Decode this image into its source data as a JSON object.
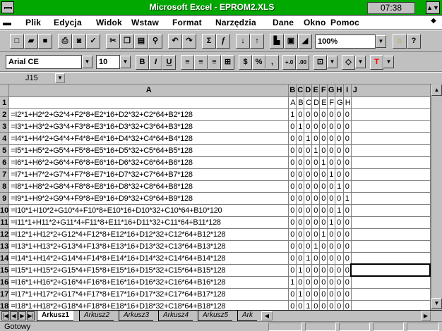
{
  "window": {
    "title": "Microsoft Excel - EPROM2.XLS",
    "clock": "07:38"
  },
  "menu": [
    "Plik",
    "Edycja",
    "Widok",
    "Wstaw",
    "Format",
    "Narzędzia",
    "Dane",
    "Okno",
    "Pomoc"
  ],
  "formatting": {
    "font": "Arial CE",
    "size": "10",
    "zoom": "100%"
  },
  "formula_bar": {
    "cell_ref": "J15"
  },
  "columns": [
    "A",
    "B",
    "C",
    "D",
    "E",
    "F",
    "G",
    "H",
    "I",
    "J"
  ],
  "row_numbers": [
    "1",
    "2",
    "3",
    "4",
    "5",
    "6",
    "7",
    "8",
    "9",
    "10",
    "11",
    "12",
    "13",
    "14",
    "15",
    "16",
    "17",
    "18",
    "19"
  ],
  "header_row": [
    "",
    "A",
    "B",
    "C",
    "D",
    "E",
    "F",
    "G",
    "H"
  ],
  "rows": [
    {
      "formula": "=I2*1+H2*2+G2*4+F2*8+E2*16+D2*32+C2*64+B2*128",
      "bits": [
        "1",
        "0",
        "0",
        "0",
        "0",
        "0",
        "0",
        "0"
      ]
    },
    {
      "formula": "=I3*1+H3*2+G3*4+F3*8+E3*16+D3*32+C3*64+B3*128",
      "bits": [
        "0",
        "1",
        "0",
        "0",
        "0",
        "0",
        "0",
        "0"
      ]
    },
    {
      "formula": "=I4*1+H4*2+G4*4+F4*8+E4*16+D4*32+C4*64+B4*128",
      "bits": [
        "0",
        "0",
        "1",
        "0",
        "0",
        "0",
        "0",
        "0"
      ]
    },
    {
      "formula": "=I5*1+H5*2+G5*4+F5*8+E5*16+D5*32+C5*64+B5*128",
      "bits": [
        "0",
        "0",
        "0",
        "1",
        "0",
        "0",
        "0",
        "0"
      ]
    },
    {
      "formula": "=I6*1+H6*2+G6*4+F6*8+E6*16+D6*32+C6*64+B6*128",
      "bits": [
        "0",
        "0",
        "0",
        "0",
        "1",
        "0",
        "0",
        "0"
      ]
    },
    {
      "formula": "=I7*1+H7*2+G7*4+F7*8+E7*16+D7*32+C7*64+B7*128",
      "bits": [
        "0",
        "0",
        "0",
        "0",
        "0",
        "1",
        "0",
        "0"
      ]
    },
    {
      "formula": "=I8*1+H8*2+G8*4+F8*8+E8*16+D8*32+C8*64+B8*128",
      "bits": [
        "0",
        "0",
        "0",
        "0",
        "0",
        "0",
        "1",
        "0"
      ]
    },
    {
      "formula": "=I9*1+H9*2+G9*4+F9*8+E9*16+D9*32+C9*64+B9*128",
      "bits": [
        "0",
        "0",
        "0",
        "0",
        "0",
        "0",
        "0",
        "1"
      ]
    },
    {
      "formula": "=I10*1+I10*2+G10*4+F10*8+E10*16+D10*32+C10*64+B10*120",
      "bits": [
        "0",
        "0",
        "0",
        "0",
        "0",
        "0",
        "1",
        "0"
      ]
    },
    {
      "formula": "=I11*1+H11*2+G11*4+F11*8+E11*16+D11*32+C11*64+B11*128",
      "bits": [
        "0",
        "0",
        "0",
        "0",
        "0",
        "1",
        "0",
        "0"
      ]
    },
    {
      "formula": "=I12*1+H12*2+G12*4+F12*8+E12*16+D12*32+C12*64+B12*128",
      "bits": [
        "0",
        "0",
        "0",
        "0",
        "1",
        "0",
        "0",
        "0"
      ]
    },
    {
      "formula": "=I13*1+H13*2+G13*4+F13*8+E13*16+D13*32+C13*64+B13*128",
      "bits": [
        "0",
        "0",
        "0",
        "1",
        "0",
        "0",
        "0",
        "0"
      ]
    },
    {
      "formula": "=I14*1+H14*2+G14*4+F14*8+E14*16+D14*32+C14*64+B14*128",
      "bits": [
        "0",
        "0",
        "1",
        "0",
        "0",
        "0",
        "0",
        "0"
      ]
    },
    {
      "formula": "=I15*1+H15*2+G15*4+F15*8+E15*16+D15*32+C15*64+B15*128",
      "bits": [
        "0",
        "1",
        "0",
        "0",
        "0",
        "0",
        "0",
        "0"
      ]
    },
    {
      "formula": "=I16*1+H16*2+G16*4+F16*8+E16*16+D16*32+C16*64+B16*128",
      "bits": [
        "1",
        "0",
        "0",
        "0",
        "0",
        "0",
        "0",
        "0"
      ]
    },
    {
      "formula": "=I17*1+H17*2+G17*4+F17*8+E17*16+D17*32+C17*64+B17*128",
      "bits": [
        "0",
        "1",
        "0",
        "0",
        "0",
        "0",
        "0",
        "0"
      ]
    },
    {
      "formula": "=I18*1+H18*2+G18*4+F18*8+E18*16+D18*32+C18*64+B18*128",
      "bits": [
        "0",
        "0",
        "1",
        "0",
        "0",
        "0",
        "0",
        "0"
      ]
    }
  ],
  "sheet_tabs": [
    "Arkusz1",
    "Arkusz2",
    "Arkusz3",
    "Arkusz4",
    "Arkusz5",
    "Ark"
  ],
  "status": {
    "text": "Gotowy"
  },
  "icons": {
    "new": "new-file-icon",
    "open": "open-folder-icon",
    "save": "save-disk-icon",
    "print": "print-icon",
    "preview": "print-preview-icon",
    "spell": "spelling-icon",
    "cut": "scissors-icon",
    "copy": "copy-icon",
    "paste": "paste-icon",
    "format_painter": "format-painter-icon",
    "undo": "undo-icon",
    "redo": "redo-icon",
    "sum": "sigma-icon",
    "function": "function-icon",
    "sort_asc": "sort-asc-icon",
    "sort_desc": "sort-desc-icon",
    "chart": "chart-wizard-icon",
    "textbox": "textbox-icon",
    "drawing": "drawing-icon",
    "tipwizard": "bulb-icon",
    "help": "help-icon"
  },
  "colors": {
    "titlebar": "#00a800",
    "chrome": "#c0c0c0",
    "font_color_accent": "#ff0000"
  }
}
